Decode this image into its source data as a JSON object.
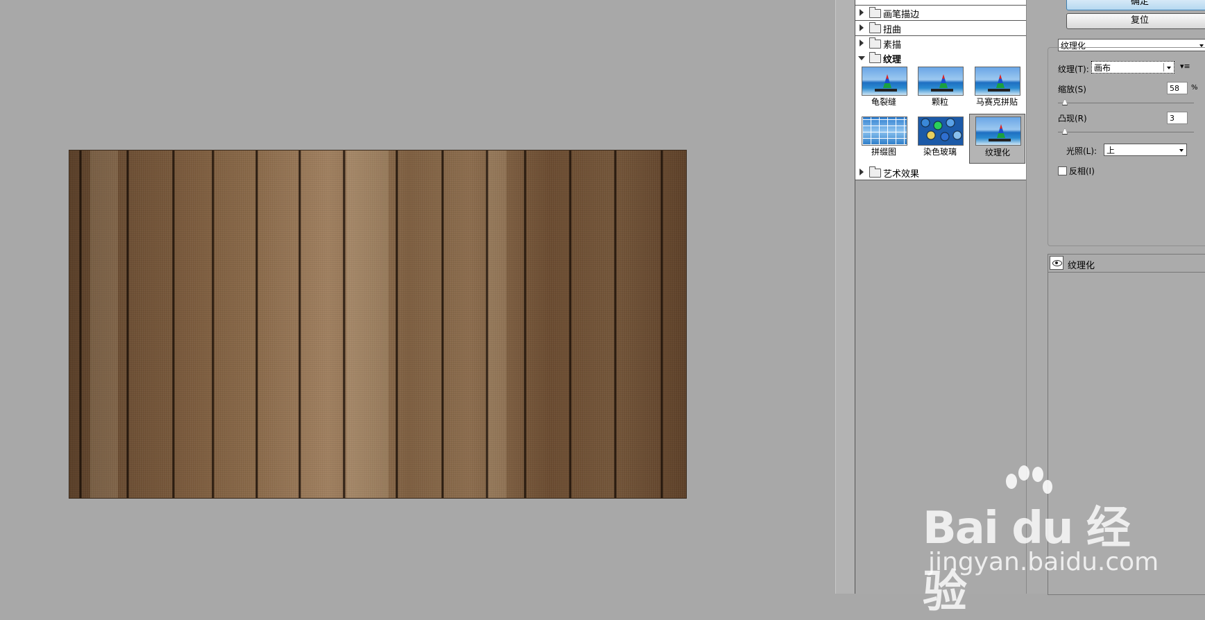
{
  "gallery": {
    "categories": [
      {
        "label": "画笔描边",
        "open": false
      },
      {
        "label": "扭曲",
        "open": false
      },
      {
        "label": "素描",
        "open": false
      },
      {
        "label": "纹理",
        "open": true
      },
      {
        "label": "艺术效果",
        "open": false
      }
    ],
    "thumbnails": [
      {
        "label": "龟裂缝"
      },
      {
        "label": "颗粒"
      },
      {
        "label": "马赛克拼贴"
      },
      {
        "label": "拼缀图"
      },
      {
        "label": "染色玻璃"
      },
      {
        "label": "纹理化",
        "selected": true
      }
    ]
  },
  "settings": {
    "ok_label": "确定",
    "reset_label": "复位",
    "filter_select": "纹理化",
    "texture_label": "纹理(T):",
    "texture_value": "画布",
    "scaling_label": "缩放(S)",
    "scaling_value": "58",
    "scaling_unit": "%",
    "relief_label": "凸现(R)",
    "relief_value": "3",
    "light_label": "光照(L):",
    "light_value": "上",
    "invert_label": "反相(I)",
    "invert_checked": false
  },
  "layers": {
    "items": [
      {
        "label": "纹理化",
        "visible": true
      }
    ]
  },
  "watermark": {
    "logo": "Bai du 经验",
    "url": "jingyan.baidu.com"
  }
}
